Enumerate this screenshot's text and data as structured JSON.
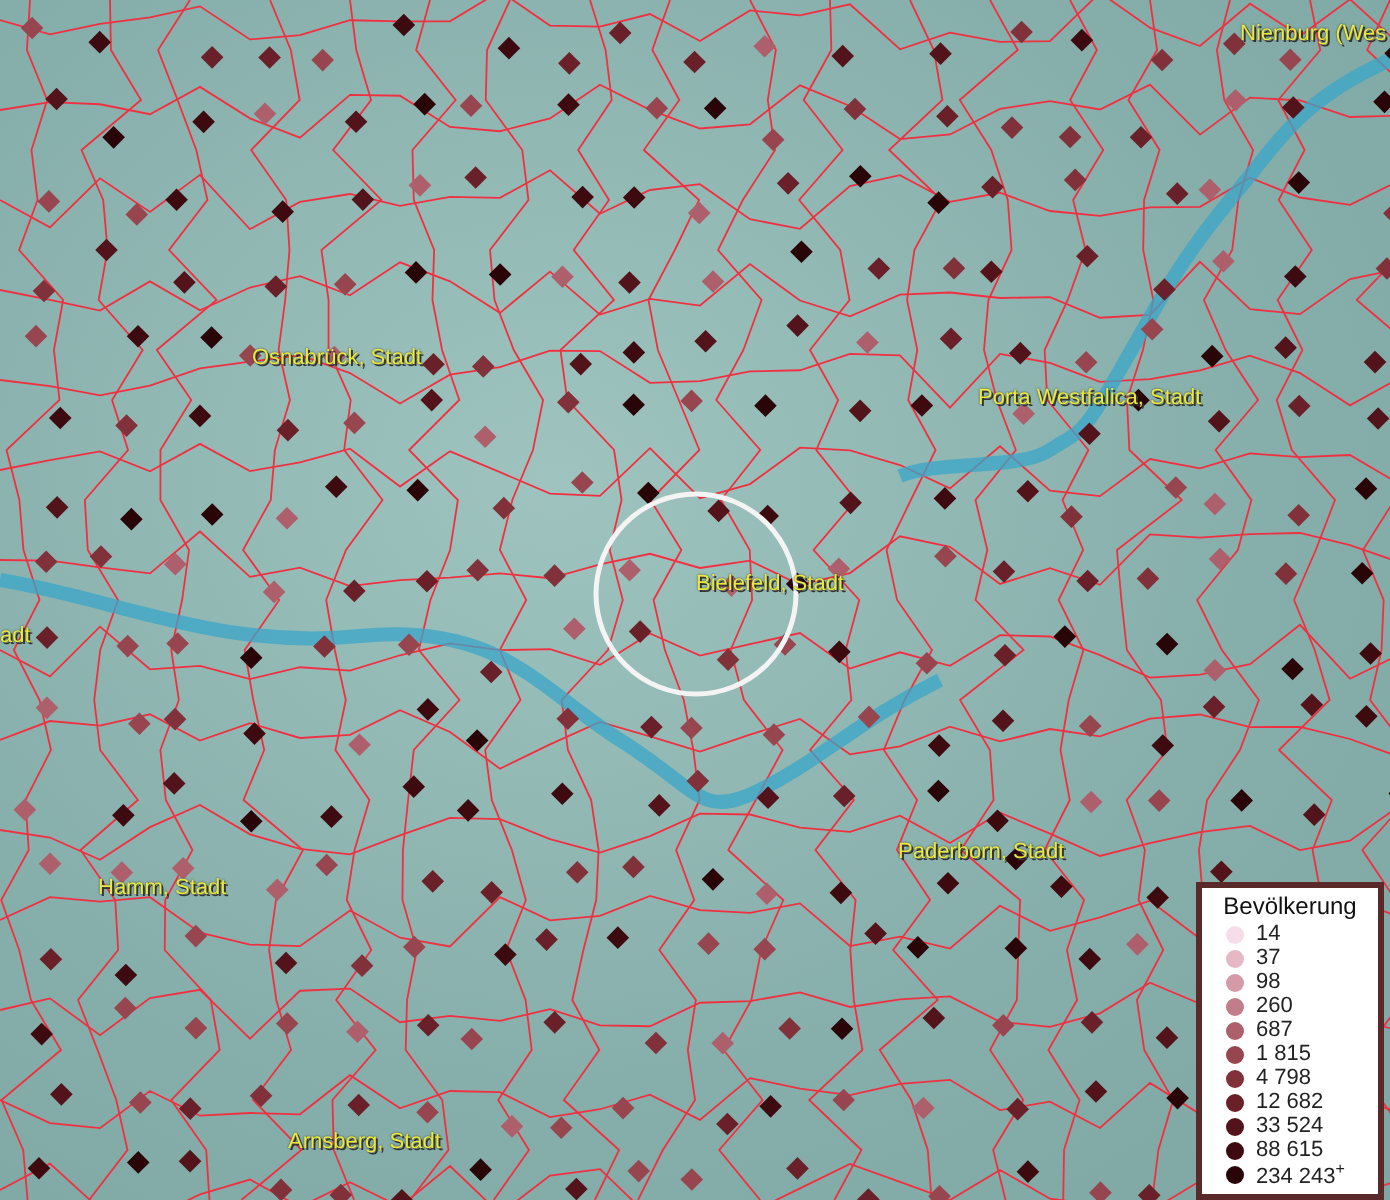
{
  "map": {
    "places": [
      {
        "label": "Nienburg (Wes"
      },
      {
        "label": "Osnabrück, Stadt"
      },
      {
        "label": "Porta Westfalica, Stadt"
      },
      {
        "label": "adt"
      },
      {
        "label": "Bielefeld, Stadt"
      },
      {
        "label": "Paderborn, Stadt"
      },
      {
        "label": "Hamm, Stadt"
      },
      {
        "label": "Arnsberg, Stadt"
      }
    ]
  },
  "legend": {
    "title": "Bevölkerung",
    "entries": [
      {
        "label": "14",
        "color": "#f6dde9"
      },
      {
        "label": "37",
        "color": "#e6b8c6"
      },
      {
        "label": "98",
        "color": "#d49aa8"
      },
      {
        "label": "260",
        "color": "#c27d8a"
      },
      {
        "label": "687",
        "color": "#ad5f6c"
      },
      {
        "label": "1 815",
        "color": "#974650"
      },
      {
        "label": "4 798",
        "color": "#80313a"
      },
      {
        "label": "12 682",
        "color": "#6a2029"
      },
      {
        "label": "33 524",
        "color": "#52131b"
      },
      {
        "label": "88 615",
        "color": "#3d0a10"
      },
      {
        "label": "234 243$^{+}$",
        "color": "#2a0508"
      }
    ]
  }
}
